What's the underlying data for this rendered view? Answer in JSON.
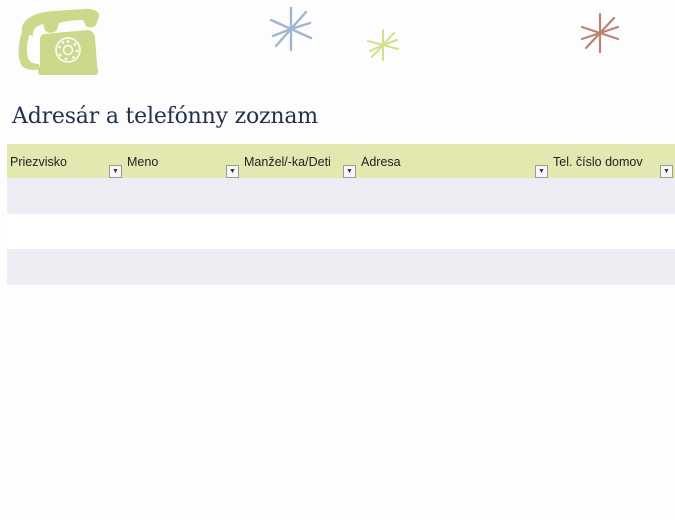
{
  "document": {
    "title": "Adresár a telefónny zoznam"
  },
  "table": {
    "columns": [
      {
        "label": "Priezvisko",
        "filter_icon": "dropdown-arrow-icon"
      },
      {
        "label": "Meno",
        "filter_icon": "dropdown-arrow-icon"
      },
      {
        "label": "Manžel/-ka/Deti",
        "filter_icon": "dropdown-arrow-icon"
      },
      {
        "label": "Adresa",
        "filter_icon": "dropdown-arrow-icon"
      },
      {
        "label": "Tel. číslo domov",
        "filter_icon": "dropdown-arrow-icon"
      }
    ],
    "rows": [
      [
        "",
        "",
        "",
        "",
        ""
      ],
      [
        "",
        "",
        "",
        "",
        ""
      ],
      [
        "",
        "",
        "",
        "",
        ""
      ]
    ]
  },
  "decorations": {
    "phone_icon": "telephone-icon",
    "stars": [
      "star-icon",
      "star-icon",
      "star-icon"
    ]
  },
  "colors": {
    "header_bg": "#e3e7b0",
    "band_bg": "#eceef3",
    "title": "#1f3050",
    "phone": "#ccd98a",
    "star_blue": "#9fb6cf",
    "star_green": "#d4de8e",
    "star_brown": "#b98473"
  }
}
